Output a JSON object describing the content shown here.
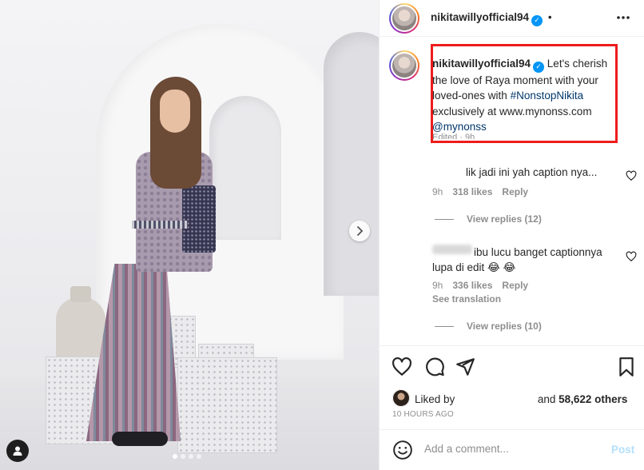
{
  "post": {
    "author": "nikitawillyofficial94",
    "header_dot": "•",
    "more_icon": "more-horizontal-icon",
    "media": {
      "slide_count": 4,
      "active_slide": 1
    }
  },
  "caption": {
    "username": "nikitawillyofficial94",
    "text_before": " Let's cherish the love of Raya moment with your loved-ones with ",
    "hashtag": "#NonstopNikita",
    "text_middle": " exclusively at www.mynonss.com ",
    "mention": "@mynonss",
    "edited_label": "Edited · 9h"
  },
  "comments": [
    {
      "text": "lik jadi ini yah caption nya...",
      "time": "9h",
      "likes": "318 likes",
      "reply_label": "Reply",
      "view_replies": "View replies (12)"
    },
    {
      "text": "ibu lucu banget captionnya lupa di edit 😂 😂",
      "time": "9h",
      "likes": "336 likes",
      "reply_label": "Reply",
      "see_translation": "See translation",
      "view_replies": "View replies (10)"
    }
  ],
  "likes": {
    "liked_by_label": "Liked by",
    "others": "58,622 others",
    "and_label": "and"
  },
  "timestamp": "10 HOURS AGO",
  "add_comment": {
    "placeholder": "Add a comment...",
    "post_label": "Post"
  },
  "colors": {
    "verified": "#0095f6",
    "link": "#00376b",
    "highlight_box": "#ee1c1c",
    "post_disabled": "#b2dffc"
  }
}
